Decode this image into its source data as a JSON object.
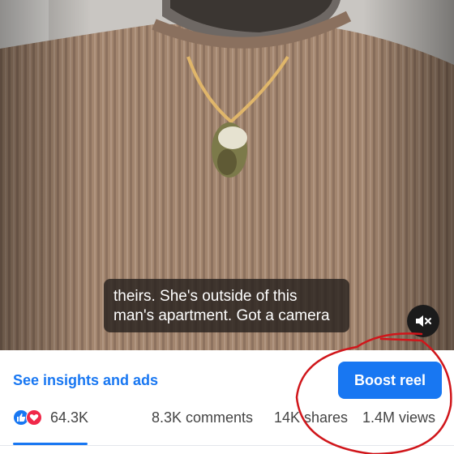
{
  "video": {
    "caption_lines": [
      "theirs. She's outside of this",
      "man's apartment. Got a camera"
    ]
  },
  "actions": {
    "insights_label": "See insights and ads",
    "boost_label": "Boost reel"
  },
  "stats": {
    "reactions_count": "64.3K",
    "comments": "8.3K comments",
    "shares": "14K shares",
    "views": "1.4M views"
  },
  "icons": {
    "mute": "speaker-muted-icon",
    "like": "like-reaction-icon",
    "love": "love-reaction-icon"
  },
  "colors": {
    "accent": "#1877f2",
    "love": "#f02849",
    "annotation": "#d0161b"
  }
}
